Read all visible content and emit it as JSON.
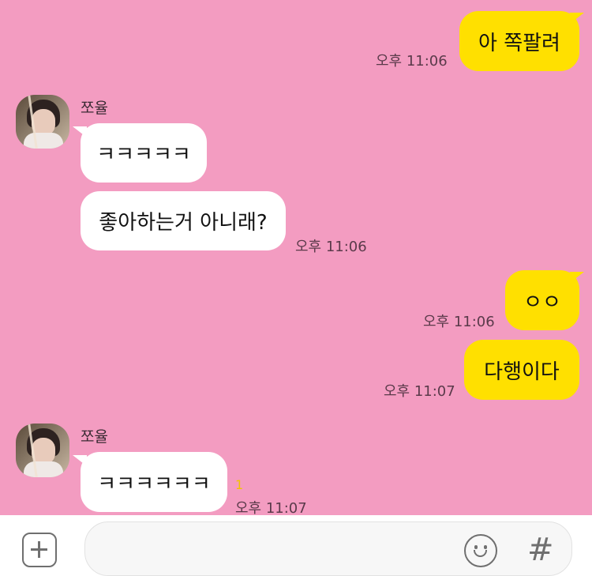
{
  "contact": {
    "name": "쪼율"
  },
  "messages": [
    {
      "from": "me",
      "text": "아 쪽팔려",
      "time": "오후 11:06"
    },
    {
      "from": "them",
      "sender": "쪼율",
      "text": "ㅋㅋㅋㅋㅋ"
    },
    {
      "from": "them",
      "text": "좋아하는거 아니래?",
      "time": "오후 11:06"
    },
    {
      "from": "me",
      "text": "ㅇㅇ",
      "time": "오후 11:06"
    },
    {
      "from": "me",
      "text": "다행이다",
      "time": "오후 11:07"
    },
    {
      "from": "them",
      "sender": "쪼율",
      "text": "ㅋㅋㅋㅋㅋㅋ",
      "time": "오후 11:07",
      "unread": "1"
    }
  ],
  "input_bar": {
    "plus_icon": "plus-square-icon",
    "emoji_icon": "smiley-icon",
    "hash_label": "#"
  },
  "colors": {
    "background": "#f39cc1",
    "my_bubble": "#ffe000",
    "their_bubble": "#ffffff",
    "unread": "#f2c400"
  }
}
